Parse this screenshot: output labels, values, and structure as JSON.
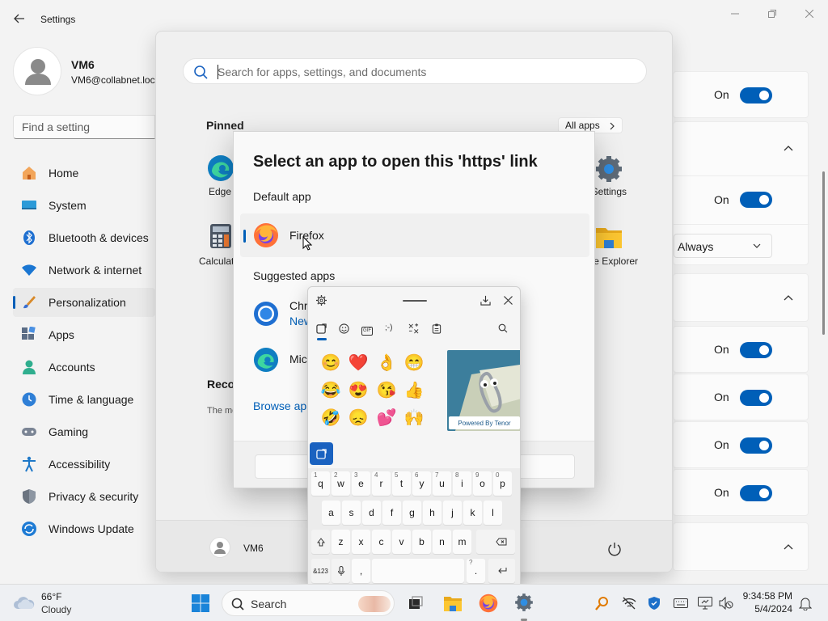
{
  "settings": {
    "title": "Settings",
    "profile": {
      "name": "VM6",
      "email": "VM6@collabnet.loc"
    },
    "search_placeholder": "Find a setting",
    "nav": [
      {
        "label": "Home",
        "icon": "home-icon"
      },
      {
        "label": "System",
        "icon": "system-icon"
      },
      {
        "label": "Bluetooth & devices",
        "icon": "bluetooth-icon"
      },
      {
        "label": "Network & internet",
        "icon": "network-icon"
      },
      {
        "label": "Personalization",
        "icon": "personalization-icon",
        "active": true
      },
      {
        "label": "Apps",
        "icon": "apps-icon"
      },
      {
        "label": "Accounts",
        "icon": "accounts-icon"
      },
      {
        "label": "Time & language",
        "icon": "time-language-icon"
      },
      {
        "label": "Gaming",
        "icon": "gaming-icon"
      },
      {
        "label": "Accessibility",
        "icon": "accessibility-icon"
      },
      {
        "label": "Privacy & security",
        "icon": "privacy-icon"
      },
      {
        "label": "Windows Update",
        "icon": "windows-update-icon"
      }
    ],
    "toggle_on_label": "On",
    "dropdown_value": "Always"
  },
  "start": {
    "search_placeholder": "Search for apps, settings, and documents",
    "pinned_label": "Pinned",
    "all_apps_label": "All apps",
    "pinned_apps": [
      {
        "label": "Edge",
        "icon": "edge-icon"
      },
      {
        "label": "Settings",
        "icon": "settings-gear-icon"
      },
      {
        "label": "Calculator",
        "icon": "calculator-icon"
      },
      {
        "label": "File Explorer",
        "icon": "file-explorer-icon"
      }
    ],
    "recommended_label": "Recommended",
    "recommended_sub": "The more you use your device",
    "user_name": "VM6"
  },
  "dialog": {
    "title": "Select an app to open this 'https' link",
    "default_label": "Default app",
    "default_app": "Firefox",
    "suggested_label": "Suggested apps",
    "suggested": [
      {
        "name": "Chrome",
        "sub": "New"
      },
      {
        "name": "Microsoft Edge",
        "sub": ""
      }
    ],
    "browse_link": "Browse apps"
  },
  "emoji_panel": {
    "tabs": [
      "recent-tab",
      "emoji-tab",
      "gif-tab",
      "kaomoji-tab",
      "symbols-tab",
      "clipboard-tab"
    ],
    "kaomoji_tab_label": ";-)",
    "gif_tab_label": "GIF",
    "emojis": [
      "😊",
      "❤️",
      "👌",
      "😁",
      "😂",
      "😍",
      "😘",
      "👍",
      "🤣",
      "😞",
      "💕",
      "🙌"
    ],
    "tenor_label": "Powered By Tenor",
    "keyboard": {
      "row1": [
        [
          "q",
          "1"
        ],
        [
          "w",
          "2"
        ],
        [
          "e",
          "3"
        ],
        [
          "r",
          "4"
        ],
        [
          "t",
          "5"
        ],
        [
          "y",
          "6"
        ],
        [
          "u",
          "7"
        ],
        [
          "i",
          "8"
        ],
        [
          "o",
          "9"
        ],
        [
          "p",
          "0"
        ]
      ],
      "row2": [
        "a",
        "s",
        "d",
        "f",
        "g",
        "h",
        "j",
        "k",
        "l"
      ],
      "row3": [
        "z",
        "x",
        "c",
        "v",
        "b",
        "n",
        "m"
      ],
      "num_key": "&123",
      "comma_key": ",",
      "period_key": ".",
      "period_sub": "?"
    }
  },
  "taskbar": {
    "weather_temp": "66°F",
    "weather_desc": "Cloudy",
    "search_label": "Search",
    "time": "9:34:58 PM",
    "date": "5/4/2024"
  },
  "colors": {
    "accent": "#005fb8",
    "toggle_on": "#005fb8"
  }
}
